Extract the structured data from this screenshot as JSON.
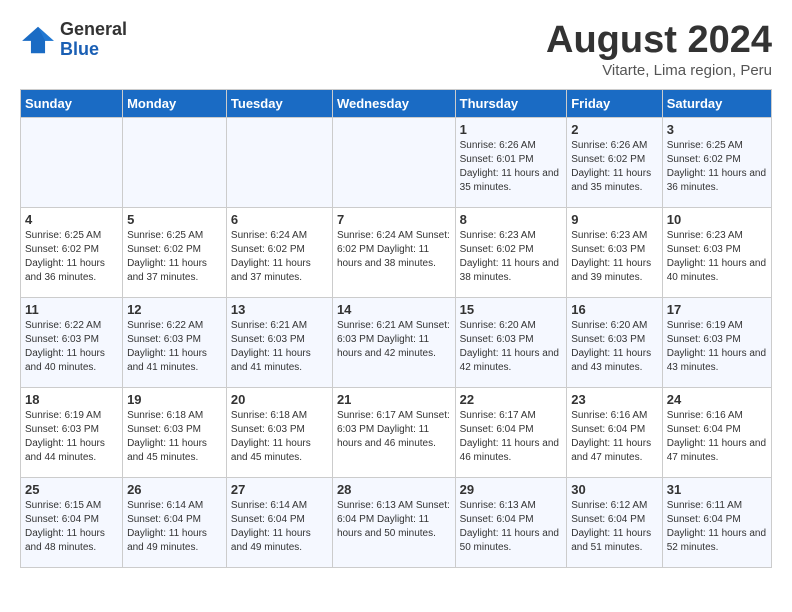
{
  "header": {
    "logo_line1": "General",
    "logo_line2": "Blue",
    "title": "August 2024",
    "subtitle": "Vitarte, Lima region, Peru"
  },
  "days_of_week": [
    "Sunday",
    "Monday",
    "Tuesday",
    "Wednesday",
    "Thursday",
    "Friday",
    "Saturday"
  ],
  "weeks": [
    [
      {
        "day": "",
        "info": ""
      },
      {
        "day": "",
        "info": ""
      },
      {
        "day": "",
        "info": ""
      },
      {
        "day": "",
        "info": ""
      },
      {
        "day": "1",
        "info": "Sunrise: 6:26 AM\nSunset: 6:01 PM\nDaylight: 11 hours\nand 35 minutes."
      },
      {
        "day": "2",
        "info": "Sunrise: 6:26 AM\nSunset: 6:02 PM\nDaylight: 11 hours\nand 35 minutes."
      },
      {
        "day": "3",
        "info": "Sunrise: 6:25 AM\nSunset: 6:02 PM\nDaylight: 11 hours\nand 36 minutes."
      }
    ],
    [
      {
        "day": "4",
        "info": "Sunrise: 6:25 AM\nSunset: 6:02 PM\nDaylight: 11 hours\nand 36 minutes."
      },
      {
        "day": "5",
        "info": "Sunrise: 6:25 AM\nSunset: 6:02 PM\nDaylight: 11 hours\nand 37 minutes."
      },
      {
        "day": "6",
        "info": "Sunrise: 6:24 AM\nSunset: 6:02 PM\nDaylight: 11 hours\nand 37 minutes."
      },
      {
        "day": "7",
        "info": "Sunrise: 6:24 AM\nSunset: 6:02 PM\nDaylight: 11 hours\nand 38 minutes."
      },
      {
        "day": "8",
        "info": "Sunrise: 6:23 AM\nSunset: 6:02 PM\nDaylight: 11 hours\nand 38 minutes."
      },
      {
        "day": "9",
        "info": "Sunrise: 6:23 AM\nSunset: 6:03 PM\nDaylight: 11 hours\nand 39 minutes."
      },
      {
        "day": "10",
        "info": "Sunrise: 6:23 AM\nSunset: 6:03 PM\nDaylight: 11 hours\nand 40 minutes."
      }
    ],
    [
      {
        "day": "11",
        "info": "Sunrise: 6:22 AM\nSunset: 6:03 PM\nDaylight: 11 hours\nand 40 minutes."
      },
      {
        "day": "12",
        "info": "Sunrise: 6:22 AM\nSunset: 6:03 PM\nDaylight: 11 hours\nand 41 minutes."
      },
      {
        "day": "13",
        "info": "Sunrise: 6:21 AM\nSunset: 6:03 PM\nDaylight: 11 hours\nand 41 minutes."
      },
      {
        "day": "14",
        "info": "Sunrise: 6:21 AM\nSunset: 6:03 PM\nDaylight: 11 hours\nand 42 minutes."
      },
      {
        "day": "15",
        "info": "Sunrise: 6:20 AM\nSunset: 6:03 PM\nDaylight: 11 hours\nand 42 minutes."
      },
      {
        "day": "16",
        "info": "Sunrise: 6:20 AM\nSunset: 6:03 PM\nDaylight: 11 hours\nand 43 minutes."
      },
      {
        "day": "17",
        "info": "Sunrise: 6:19 AM\nSunset: 6:03 PM\nDaylight: 11 hours\nand 43 minutes."
      }
    ],
    [
      {
        "day": "18",
        "info": "Sunrise: 6:19 AM\nSunset: 6:03 PM\nDaylight: 11 hours\nand 44 minutes."
      },
      {
        "day": "19",
        "info": "Sunrise: 6:18 AM\nSunset: 6:03 PM\nDaylight: 11 hours\nand 45 minutes."
      },
      {
        "day": "20",
        "info": "Sunrise: 6:18 AM\nSunset: 6:03 PM\nDaylight: 11 hours\nand 45 minutes."
      },
      {
        "day": "21",
        "info": "Sunrise: 6:17 AM\nSunset: 6:03 PM\nDaylight: 11 hours\nand 46 minutes."
      },
      {
        "day": "22",
        "info": "Sunrise: 6:17 AM\nSunset: 6:04 PM\nDaylight: 11 hours\nand 46 minutes."
      },
      {
        "day": "23",
        "info": "Sunrise: 6:16 AM\nSunset: 6:04 PM\nDaylight: 11 hours\nand 47 minutes."
      },
      {
        "day": "24",
        "info": "Sunrise: 6:16 AM\nSunset: 6:04 PM\nDaylight: 11 hours\nand 47 minutes."
      }
    ],
    [
      {
        "day": "25",
        "info": "Sunrise: 6:15 AM\nSunset: 6:04 PM\nDaylight: 11 hours\nand 48 minutes."
      },
      {
        "day": "26",
        "info": "Sunrise: 6:14 AM\nSunset: 6:04 PM\nDaylight: 11 hours\nand 49 minutes."
      },
      {
        "day": "27",
        "info": "Sunrise: 6:14 AM\nSunset: 6:04 PM\nDaylight: 11 hours\nand 49 minutes."
      },
      {
        "day": "28",
        "info": "Sunrise: 6:13 AM\nSunset: 6:04 PM\nDaylight: 11 hours\nand 50 minutes."
      },
      {
        "day": "29",
        "info": "Sunrise: 6:13 AM\nSunset: 6:04 PM\nDaylight: 11 hours\nand 50 minutes."
      },
      {
        "day": "30",
        "info": "Sunrise: 6:12 AM\nSunset: 6:04 PM\nDaylight: 11 hours\nand 51 minutes."
      },
      {
        "day": "31",
        "info": "Sunrise: 6:11 AM\nSunset: 6:04 PM\nDaylight: 11 hours\nand 52 minutes."
      }
    ]
  ]
}
